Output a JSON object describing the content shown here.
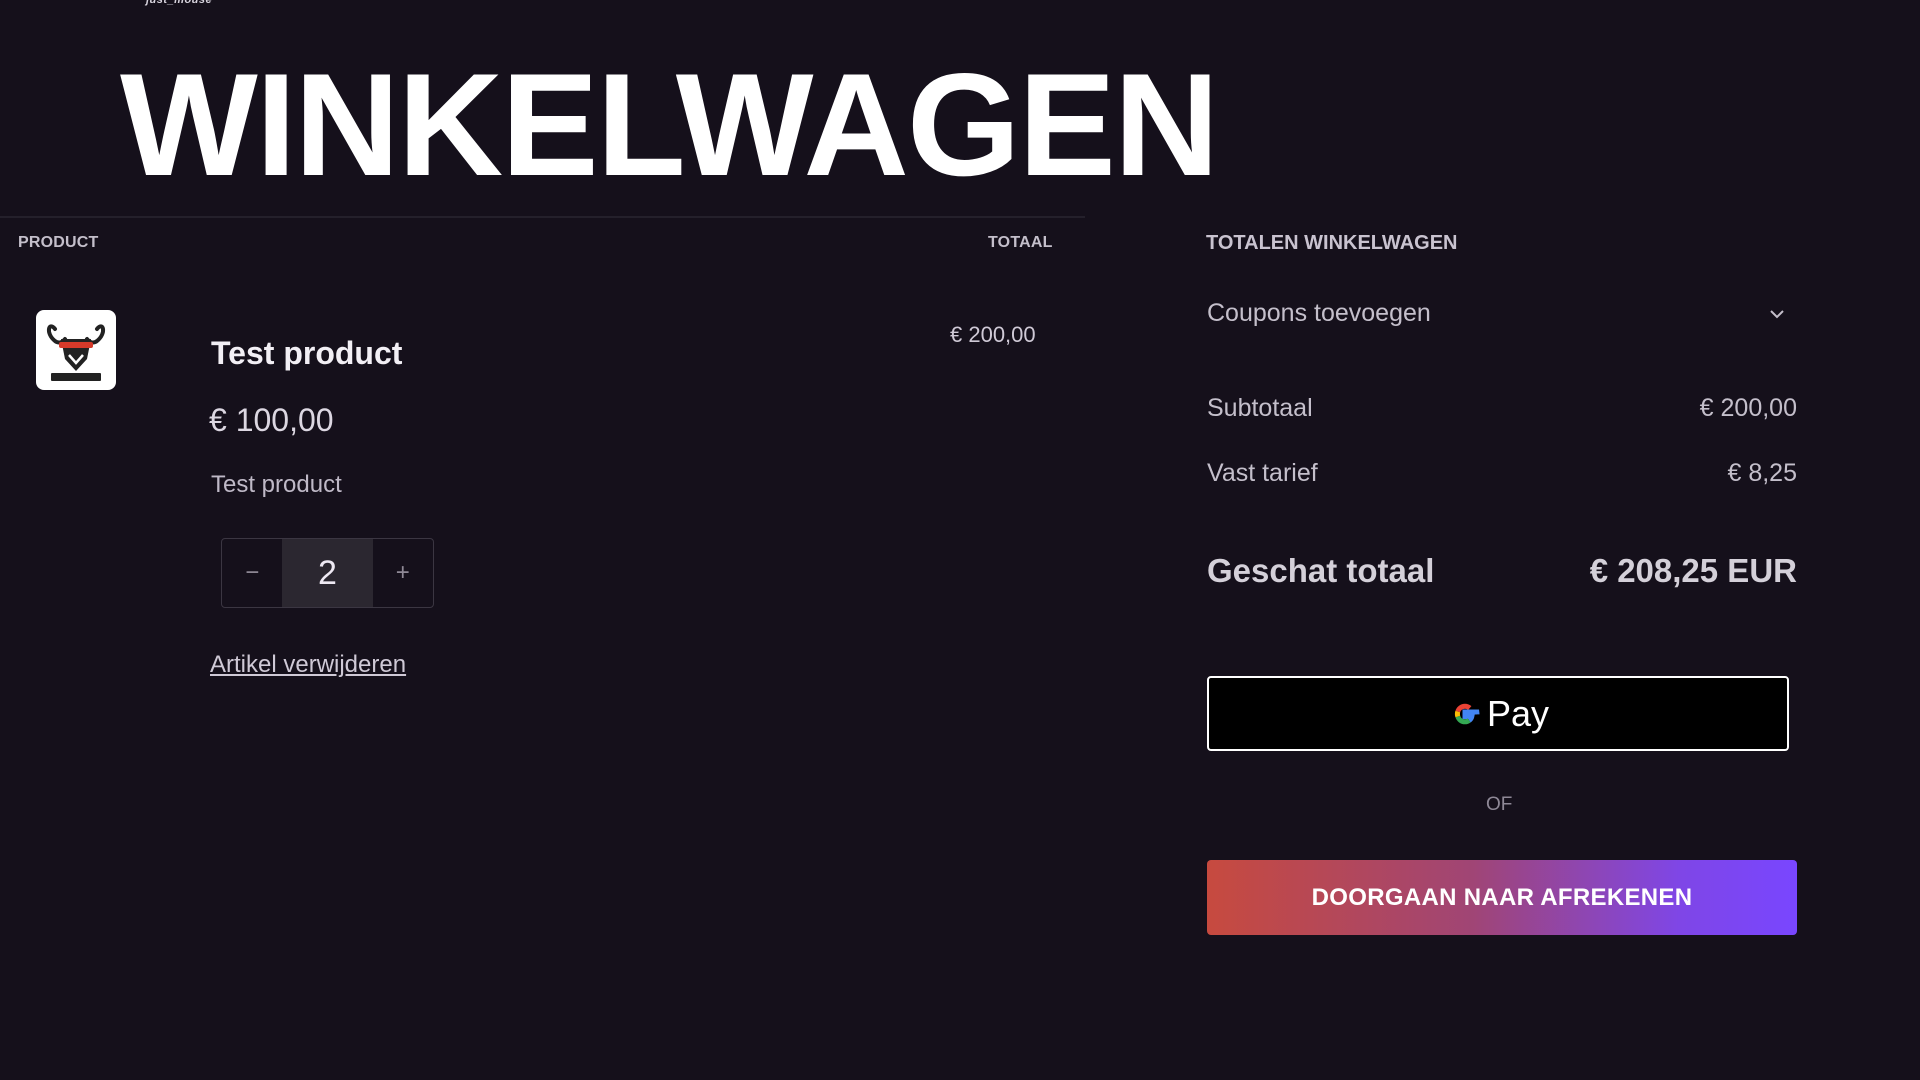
{
  "header": {
    "logo_text": "just_mouse",
    "title": "WINKELWAGEN"
  },
  "cart": {
    "column_product": "PRODUCT",
    "column_total": "TOTAAL",
    "items": [
      {
        "name": "Test product",
        "price": "€ 100,00",
        "variant": "Test product",
        "quantity": "2",
        "decrement_label": "−",
        "increment_label": "+",
        "remove_label": "Artikel verwijderen",
        "line_total": "€ 200,00",
        "thumbnail_icon": "goat-logo-icon"
      }
    ]
  },
  "summary": {
    "heading": "TOTALEN WINKELWAGEN",
    "coupon_label": "Coupons toevoegen",
    "subtotal_label": "Subtotaal",
    "subtotal_value": "€ 200,00",
    "shipping_label": "Vast tarief",
    "shipping_value": "€ 8,25",
    "estimate_label": "Geschat totaal",
    "estimate_value": "€ 208,25 EUR"
  },
  "payment": {
    "gpay_label": "Pay",
    "or_text": "OF",
    "checkout_label": "DOORGAAN NAAR AFREKENEN"
  },
  "colors": {
    "background": "#15101b",
    "checkout_gradient_start": "#c74a3f",
    "checkout_gradient_end": "#7946ff",
    "gpay_bg": "#000000"
  }
}
